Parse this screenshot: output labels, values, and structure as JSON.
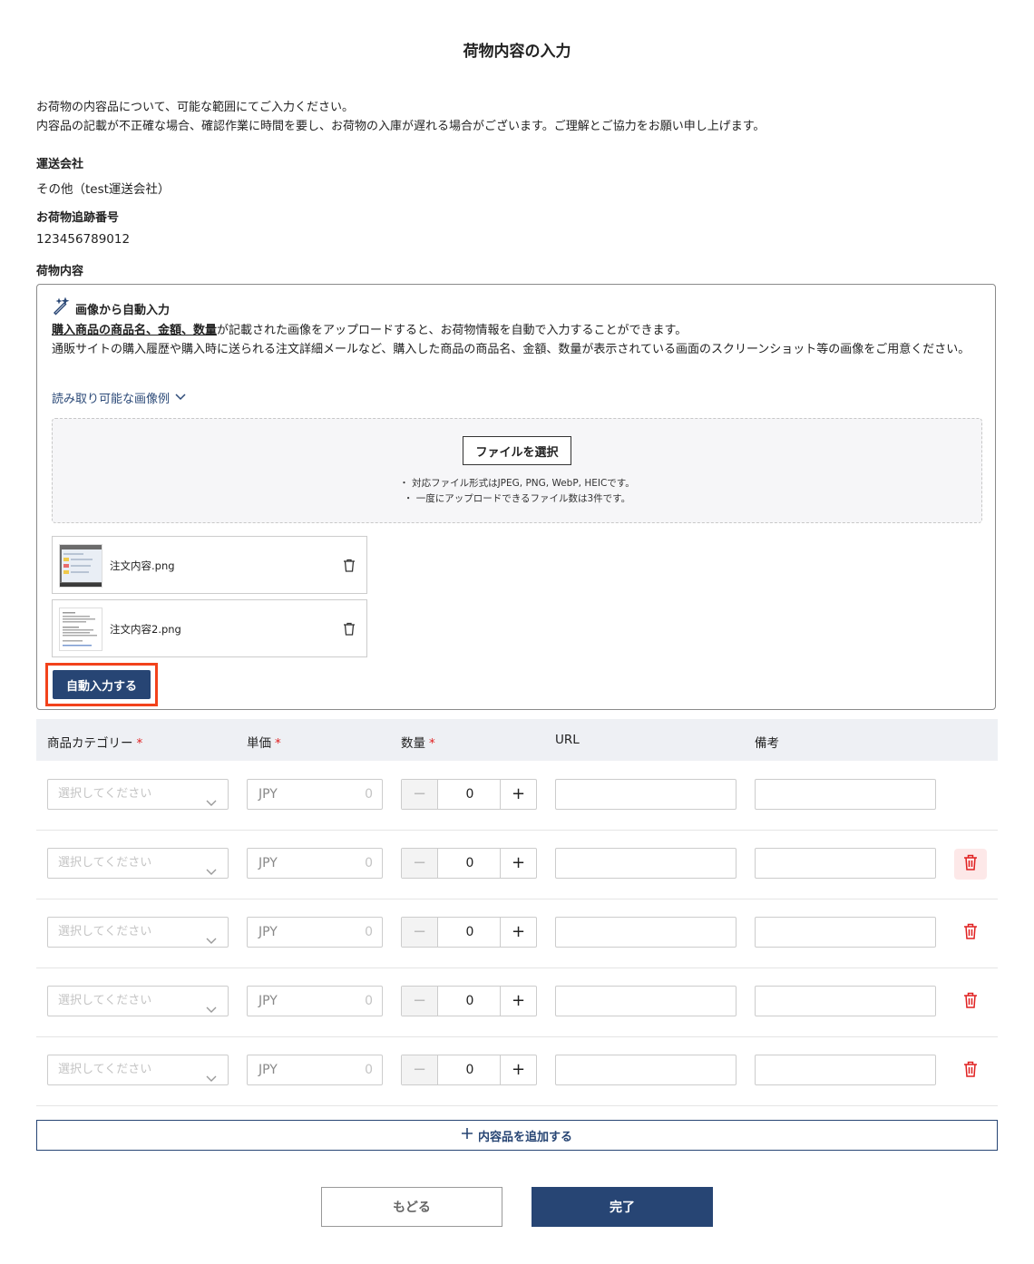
{
  "page_title": "荷物内容の入力",
  "intro": {
    "line1": "お荷物の内容品について、可能な範囲にてご入力ください。",
    "line2": "内容品の記載が不正確な場合、確認作業に時間を要し、お荷物の入庫が遅れる場合がございます。ご理解とご協力をお願い申し上げます。"
  },
  "carrier": {
    "label": "運送会社",
    "value": "その他（test運送会社）"
  },
  "tracking": {
    "label": "お荷物追跡番号",
    "value": "123456789012"
  },
  "contents_label": "荷物内容",
  "auto_input": {
    "title": "画像から自動入力",
    "desc_bold": "購入商品の商品名、金額、数量",
    "desc_rest": "が記載された画像をアップロードすると、お荷物情報を自動で入力することができます。",
    "desc_line2": "通販サイトの購入履歴や購入時に送られる注文詳細メールなど、購入した商品の商品名、金額、数量が表示されている画面のスクリーンショット等の画像をご用意ください。",
    "examples_link": "読み取り可能な画像例",
    "file_button": "ファイルを選択",
    "note1": "・ 対応ファイル形式はJPEG, PNG, WebP, HEICです。",
    "note2": "・ 一度にアップロードできるファイル数は3件です。",
    "files": [
      {
        "name": "注文内容.png"
      },
      {
        "name": "注文内容2.png"
      }
    ],
    "submit": "自動入力する"
  },
  "table": {
    "headers": {
      "category": "商品カテゴリー",
      "price": "単価",
      "qty": "数量",
      "url": "URL",
      "note": "備考"
    },
    "required_mark": "*",
    "rows": [
      {
        "category_placeholder": "選択してください",
        "currency": "JPY",
        "price": "0",
        "qty": "0"
      },
      {
        "category_placeholder": "選択してください",
        "currency": "JPY",
        "price": "0",
        "qty": "0"
      },
      {
        "category_placeholder": "選択してください",
        "currency": "JPY",
        "price": "0",
        "qty": "0"
      },
      {
        "category_placeholder": "選択してください",
        "currency": "JPY",
        "price": "0",
        "qty": "0"
      },
      {
        "category_placeholder": "選択してください",
        "currency": "JPY",
        "price": "0",
        "qty": "0"
      }
    ]
  },
  "add_item": "内容品を追加する",
  "back_button": "もどる",
  "done_button": "完了",
  "colors": {
    "primary": "#274574",
    "danger": "#e02020",
    "highlight": "#f2421b"
  }
}
